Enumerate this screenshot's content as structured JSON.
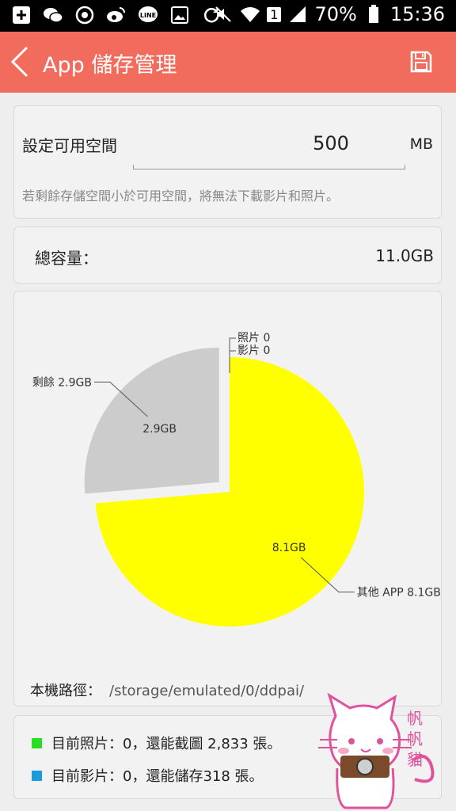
{
  "status_bar": {
    "battery": "70%",
    "time": "15:36",
    "sim": "1"
  },
  "app_bar": {
    "title": "App 儲存管理"
  },
  "space_setting": {
    "label": "設定可用空間",
    "value": "500",
    "unit": "MB",
    "hint": "若剩餘存儲空間小於可用空間，將無法下載影片和照片。"
  },
  "capacity": {
    "label": "總容量：",
    "value": "11.0GB"
  },
  "chart_data": {
    "type": "pie",
    "slices": [
      {
        "name": "其他 APP",
        "value": 8.1,
        "color": "#ffff00",
        "inner_label": "8.1GB",
        "outer_label": "其他 APP 8.1GB"
      },
      {
        "name": "剩餘",
        "value": 2.9,
        "color": "#cccccc",
        "inner_label": "2.9GB",
        "outer_label": "剩餘 2.9GB"
      },
      {
        "name": "影片",
        "value": 0,
        "color": "#ffff00",
        "outer_label": "影片 0"
      },
      {
        "name": "照片",
        "value": 0,
        "color": "#ffff00",
        "outer_label": "照片 0"
      }
    ]
  },
  "path": {
    "label": "本機路徑：",
    "value": "/storage/emulated/0/ddpai/"
  },
  "info": [
    {
      "text": "目前照片：0，還能截圖 2,833 張。",
      "color": "#2bdc25"
    },
    {
      "text": "目前影片：0，還能儲存318 張。",
      "color": "#1a9bdc"
    }
  ],
  "mascot": {
    "text": "帆帆貓"
  }
}
